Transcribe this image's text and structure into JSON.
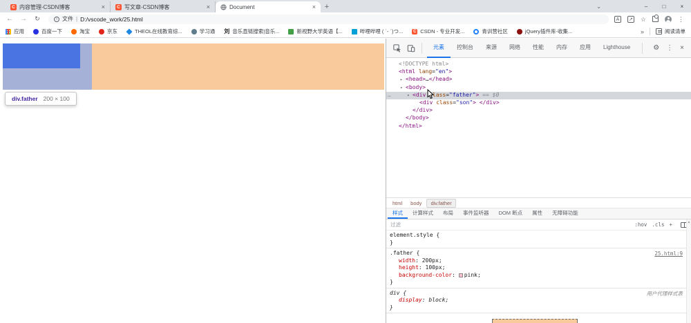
{
  "browser": {
    "tabs": [
      {
        "title": "内容管理-CSDN博客",
        "favicon": "csdn",
        "favicon_letter": "C",
        "active": false
      },
      {
        "title": "写文章-CSDN博客",
        "favicon": "csdn",
        "favicon_letter": "C",
        "active": false
      },
      {
        "title": "Document",
        "favicon": "globe",
        "favicon_letter": "",
        "active": true
      }
    ],
    "window_controls": {
      "tab_search": "⌄",
      "minimize": "–",
      "maximize": "□",
      "close": "×"
    },
    "toolbar": {
      "back": "←",
      "forward": "→",
      "reload": "↻",
      "address": {
        "info": "i",
        "scheme_label": "文件",
        "separator": "|",
        "url": "D:/vscode_work/25.html"
      },
      "translate_glyph": "A",
      "share_glyph": "↗",
      "star": "☆",
      "menu": "⋮"
    },
    "bookmarks": {
      "items": [
        {
          "label": "应用",
          "icon": "apps-grid",
          "color": "#4285f4",
          "char": ""
        },
        {
          "label": "百度一下",
          "icon": "circle",
          "color": "#2932e1",
          "char": ""
        },
        {
          "label": "淘宝",
          "icon": "circle",
          "color": "#ff6a00",
          "char": ""
        },
        {
          "label": "京东",
          "icon": "circle",
          "color": "#e1251b",
          "char": ""
        },
        {
          "label": "THEOL在线教育综...",
          "icon": "diamond",
          "color": "#1e88e5",
          "char": ""
        },
        {
          "label": "学习通",
          "icon": "circle",
          "color": "#607d8b",
          "char": ""
        },
        {
          "label": "音乐直链搜索|音乐...",
          "icon": "char",
          "color": "#1a1a1a",
          "char": "刘"
        },
        {
          "label": "新视野大学英语【...",
          "icon": "square",
          "color": "#43a047",
          "char": ""
        },
        {
          "label": "哔哩哔哩 ( ´- ´)つ...",
          "icon": "square",
          "color": "#00a1d6",
          "char": ""
        },
        {
          "label": "CSDN - 专业开发...",
          "icon": "csdn",
          "color": "#fc5531",
          "char": "C"
        },
        {
          "label": "青训营社区",
          "icon": "ring",
          "color": "#1e80ff",
          "char": ""
        },
        {
          "label": "jQuery插件库-收集...",
          "icon": "circle",
          "color": "#8b1010",
          "char": ""
        }
      ],
      "overflow": "»",
      "reading_list": "阅读清单"
    }
  },
  "page": {
    "tooltip": {
      "selector": "div.father",
      "dims": "200 × 100"
    },
    "overlay_colors": {
      "content": "#a5b1d6",
      "son": "#4a74e2",
      "margin": "#f9cb9c"
    }
  },
  "devtools": {
    "tabs": [
      {
        "label": "元素",
        "active": true
      },
      {
        "label": "控制台",
        "active": false
      },
      {
        "label": "来源",
        "active": false
      },
      {
        "label": "网络",
        "active": false
      },
      {
        "label": "性能",
        "active": false
      },
      {
        "label": "内存",
        "active": false
      },
      {
        "label": "应用",
        "active": false
      },
      {
        "label": "Lighthouse",
        "active": false
      }
    ],
    "toolbar_right": {
      "gear": "⚙",
      "menu": "⋮",
      "close": "×"
    },
    "dom_rows": [
      {
        "indent": 0,
        "arrow": "",
        "selected": false,
        "gutter": "",
        "segments": [
          {
            "text": "<!DOCTYPE html>",
            "cls": "doctype"
          }
        ]
      },
      {
        "indent": 0,
        "arrow": "",
        "selected": false,
        "gutter": "",
        "segments": [
          {
            "text": "<html ",
            "cls": "tag"
          },
          {
            "text": "lang",
            "cls": "attr"
          },
          {
            "text": "=",
            "cls": "plain"
          },
          {
            "text": "\"en\"",
            "cls": "val"
          },
          {
            "text": ">",
            "cls": "tag"
          }
        ]
      },
      {
        "indent": 1,
        "arrow": "▸",
        "selected": false,
        "gutter": "",
        "segments": [
          {
            "text": "<head>",
            "cls": "tag"
          },
          {
            "text": "…",
            "cls": "plain"
          },
          {
            "text": "</head>",
            "cls": "tag"
          }
        ]
      },
      {
        "indent": 1,
        "arrow": "▾",
        "selected": false,
        "gutter": "",
        "segments": [
          {
            "text": "<body>",
            "cls": "tag"
          }
        ]
      },
      {
        "indent": 2,
        "arrow": "▾",
        "selected": true,
        "gutter": "…",
        "segments": [
          {
            "text": "<div ",
            "cls": "tag"
          },
          {
            "text": "class",
            "cls": "attr"
          },
          {
            "text": "=",
            "cls": "plain"
          },
          {
            "text": "\"father\"",
            "cls": "val"
          },
          {
            "text": ">",
            "cls": "tag"
          },
          {
            "text": " == $0",
            "cls": "dollar"
          }
        ]
      },
      {
        "indent": 3,
        "arrow": "",
        "selected": false,
        "gutter": "",
        "segments": [
          {
            "text": "<div ",
            "cls": "tag"
          },
          {
            "text": "class",
            "cls": "attr"
          },
          {
            "text": "=",
            "cls": "plain"
          },
          {
            "text": "\"son\"",
            "cls": "val"
          },
          {
            "text": "> ",
            "cls": "tag"
          },
          {
            "text": "</div>",
            "cls": "tag"
          }
        ]
      },
      {
        "indent": 2,
        "arrow": "",
        "selected": false,
        "gutter": "",
        "segments": [
          {
            "text": "</div>",
            "cls": "tag"
          }
        ]
      },
      {
        "indent": 1,
        "arrow": "",
        "selected": false,
        "gutter": "",
        "segments": [
          {
            "text": "</body>",
            "cls": "tag"
          }
        ]
      },
      {
        "indent": 0,
        "arrow": "",
        "selected": false,
        "gutter": "",
        "segments": [
          {
            "text": "</html>",
            "cls": "tag"
          }
        ]
      }
    ],
    "crumbs": [
      {
        "label": "html",
        "selected": false
      },
      {
        "label": "body",
        "selected": false
      },
      {
        "label": "div.father",
        "selected": true
      }
    ],
    "style_tabs": [
      {
        "label": "样式",
        "active": true
      },
      {
        "label": "计算样式",
        "active": false
      },
      {
        "label": "布局",
        "active": false
      },
      {
        "label": "事件监听器",
        "active": false
      },
      {
        "label": "DOM 断点",
        "active": false
      },
      {
        "label": "属性",
        "active": false
      },
      {
        "label": "无障碍功能",
        "active": false
      }
    ],
    "filter": {
      "placeholder": "过滤",
      "toggles": [
        ":hov",
        ".cls",
        "+"
      ]
    },
    "rules": [
      {
        "selector": "element.style",
        "link": "",
        "ua": false,
        "props": []
      },
      {
        "selector": ".father",
        "link": "25.html:9",
        "ua": false,
        "props": [
          {
            "name": "width",
            "value": "200px",
            "swatch": ""
          },
          {
            "name": "height",
            "value": "100px",
            "swatch": ""
          },
          {
            "name": "background-color",
            "value": "pink",
            "swatch": "#ffc0cb"
          }
        ]
      },
      {
        "selector": "div",
        "link": "用户代理样式表",
        "ua": true,
        "props": [
          {
            "name": "display",
            "value": "block",
            "swatch": ""
          }
        ]
      }
    ]
  }
}
